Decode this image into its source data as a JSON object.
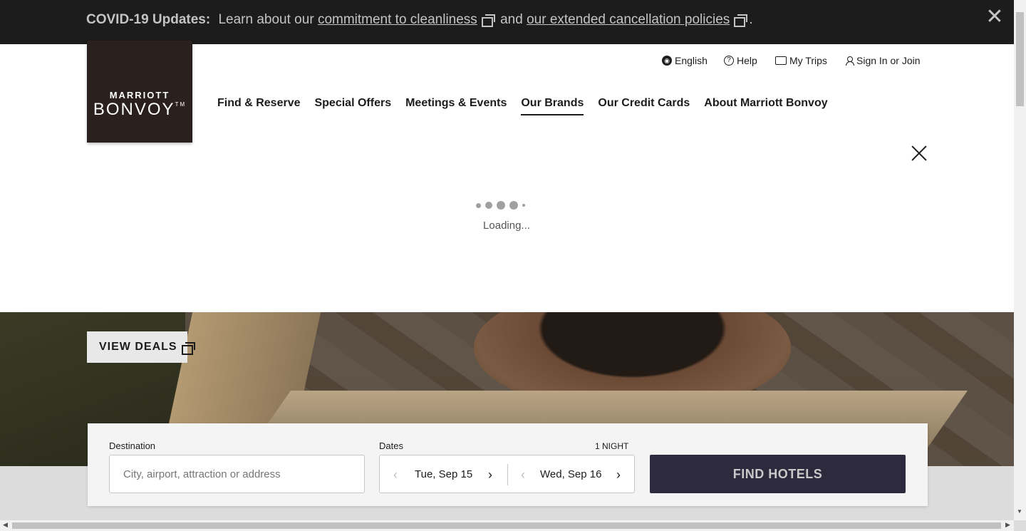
{
  "covid": {
    "title": "COVID-19 Updates:",
    "text_before": "Learn about our",
    "link1": "commitment to cleanliness",
    "text_mid": "and",
    "link2": "our extended cancellation policies",
    "text_end": ".",
    "close": "✕"
  },
  "logo": {
    "small": "MARRIOTT",
    "big": "BONVOY",
    "tm": "TM"
  },
  "utility": {
    "language": "English",
    "help": "Help",
    "trips": "My Trips",
    "signin": "Sign In or Join",
    "help_glyph": "?",
    "globe_glyph": "◉"
  },
  "nav": [
    {
      "label": "Find & Reserve"
    },
    {
      "label": "Special Offers"
    },
    {
      "label": "Meetings & Events"
    },
    {
      "label": "Our Brands",
      "active": true
    },
    {
      "label": "Our Credit Cards"
    },
    {
      "label": "About Marriott Bonvoy"
    }
  ],
  "loading": {
    "text": "Loading..."
  },
  "hero": {
    "cta": "VIEW DEALS"
  },
  "search": {
    "destination_label": "Destination",
    "destination_placeholder": "City, airport, attraction or address",
    "dates_label": "Dates",
    "nights": "1 NIGHT",
    "check_in": "Tue, Sep 15",
    "check_out": "Wed, Sep 16",
    "prev_glyph": "‹",
    "next_glyph": "›",
    "submit": "FIND HOTELS"
  },
  "colors": {
    "banner_bg": "#1c1c1c",
    "logo_bg": "#2a201d",
    "button_bg": "#2c2a3c",
    "accent": "#ff8d6b"
  },
  "icons": [
    "globe-icon",
    "help-icon",
    "suitcase-icon",
    "user-icon",
    "external-link-icon",
    "close-icon",
    "chevron-left-icon",
    "chevron-right-icon"
  ]
}
